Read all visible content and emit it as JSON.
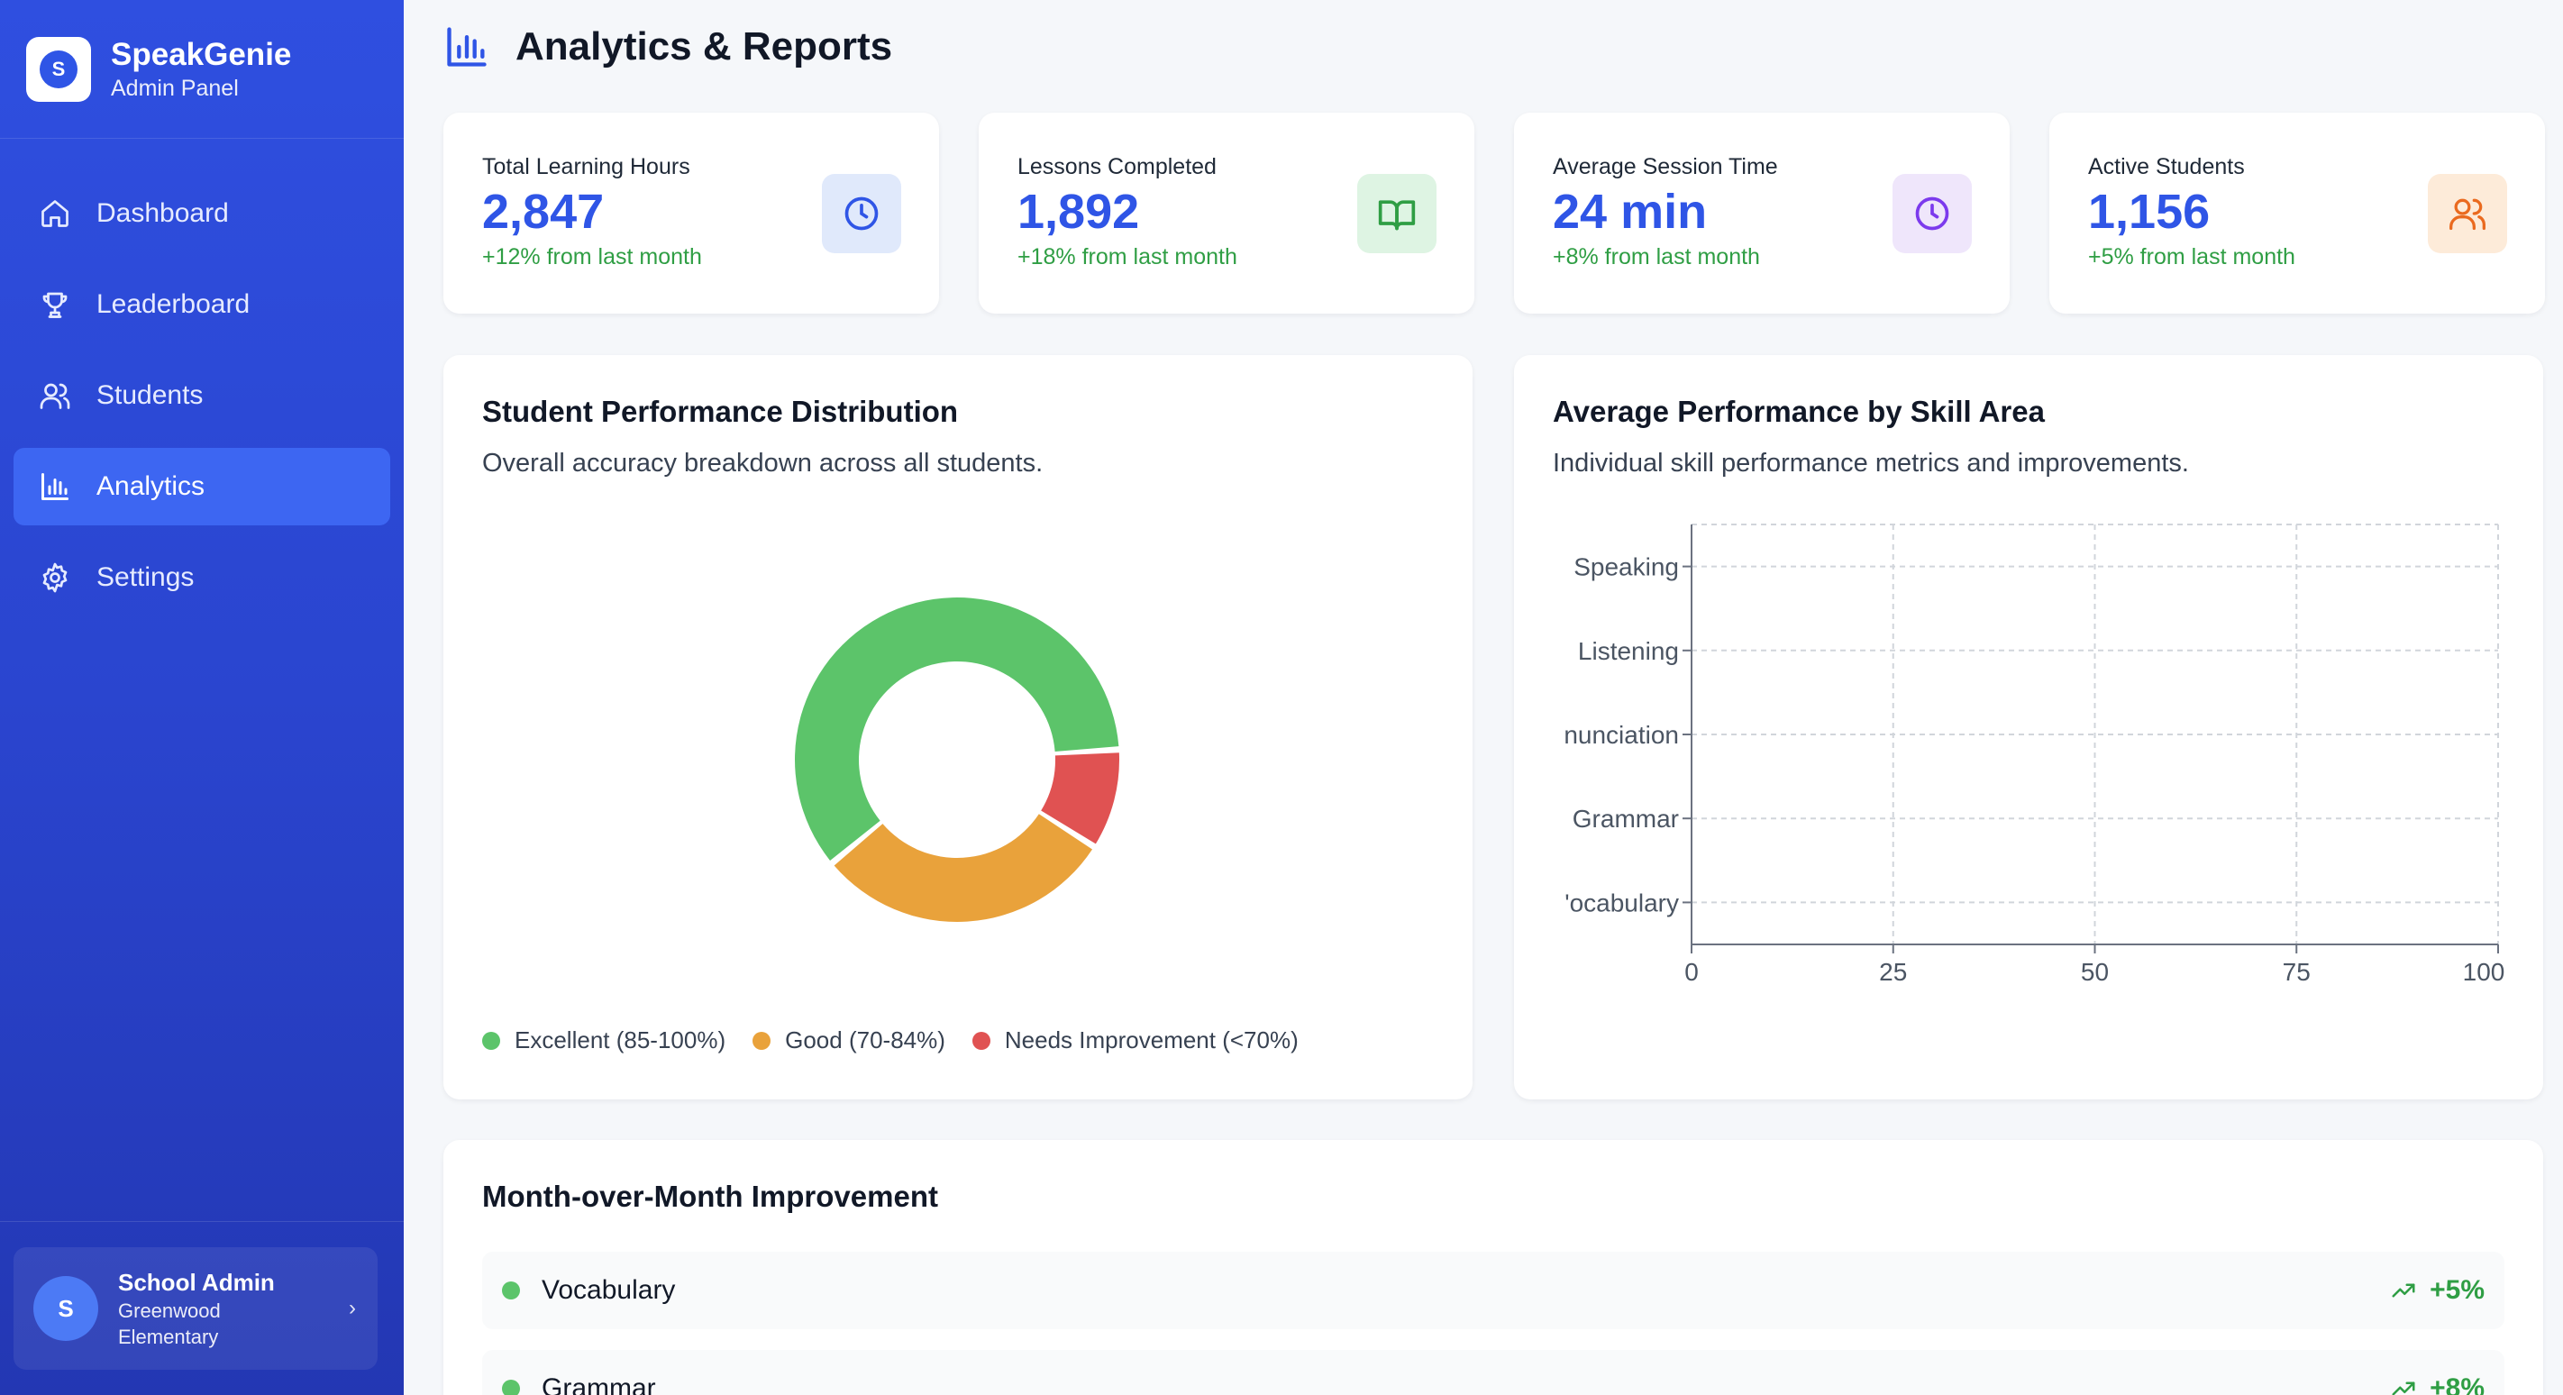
{
  "brand": {
    "name": "SpeakGenie",
    "subtitle": "Admin Panel",
    "logo_letter": "S"
  },
  "nav": [
    {
      "label": "Dashboard",
      "icon": "home-icon",
      "active": false
    },
    {
      "label": "Leaderboard",
      "icon": "trophy-icon",
      "active": false
    },
    {
      "label": "Students",
      "icon": "users-icon",
      "active": false
    },
    {
      "label": "Analytics",
      "icon": "bar-chart-icon",
      "active": true
    },
    {
      "label": "Settings",
      "icon": "gear-icon",
      "active": false
    }
  ],
  "user": {
    "initial": "S",
    "name": "School Admin",
    "org": "Greenwood Elementary"
  },
  "header": {
    "title": "Analytics & Reports"
  },
  "stats": [
    {
      "label": "Total Learning Hours",
      "value": "2,847",
      "delta": "+12% from last month",
      "icon": "clock-icon",
      "icon_color": "#2f55e6",
      "icon_bg": "#e0e9fb"
    },
    {
      "label": "Lessons Completed",
      "value": "1,892",
      "delta": "+18% from last month",
      "icon": "book-icon",
      "icon_color": "#2f9e44",
      "icon_bg": "#def4e3"
    },
    {
      "label": "Average Session Time",
      "value": "24 min",
      "delta": "+8% from last month",
      "icon": "clock-icon",
      "icon_color": "#7c3aed",
      "icon_bg": "#efe6fb"
    },
    {
      "label": "Active Students",
      "value": "1,156",
      "delta": "+5% from last month",
      "icon": "users-icon",
      "icon_color": "#ea6a1f",
      "icon_bg": "#fdebd9"
    }
  ],
  "distribution": {
    "title": "Student Performance Distribution",
    "subtitle": "Overall accuracy breakdown across all students.",
    "legend": [
      {
        "label": "Excellent (85-100%)",
        "color": "#5cc46a"
      },
      {
        "label": "Good (70-84%)",
        "color": "#e9a23b"
      },
      {
        "label": "Needs Improvement (<70%)",
        "color": "#e05252"
      }
    ]
  },
  "skills": {
    "title": "Average Performance by Skill Area",
    "subtitle": "Individual skill performance metrics and improvements."
  },
  "improvement": {
    "title": "Month-over-Month Improvement",
    "rows": [
      {
        "label": "Vocabulary",
        "change": "+5%"
      },
      {
        "label": "Grammar",
        "change": "+8%"
      }
    ]
  },
  "chart_data": [
    {
      "type": "pie",
      "categories": [
        "Excellent (85-100%)",
        "Good (70-84%)",
        "Needs Improvement (<70%)"
      ],
      "values": [
        60,
        30,
        10
      ],
      "colors": [
        "#5cc46a",
        "#e9a23b",
        "#e05252"
      ],
      "donut": true,
      "legend": "bottom"
    },
    {
      "type": "bar",
      "orientation": "horizontal",
      "categories": [
        "Speaking",
        "Listening",
        "Pronunciation",
        "Grammar",
        "Vocabulary"
      ],
      "category_tick_labels": [
        "Speaking",
        "Listening",
        "nunciation",
        "Grammar",
        "'ocabulary"
      ],
      "values": [],
      "xlim": [
        0,
        100
      ],
      "xticks": [
        "0",
        "25",
        "50",
        "75",
        "100"
      ],
      "grid": true,
      "grid_style": "dashed"
    }
  ]
}
